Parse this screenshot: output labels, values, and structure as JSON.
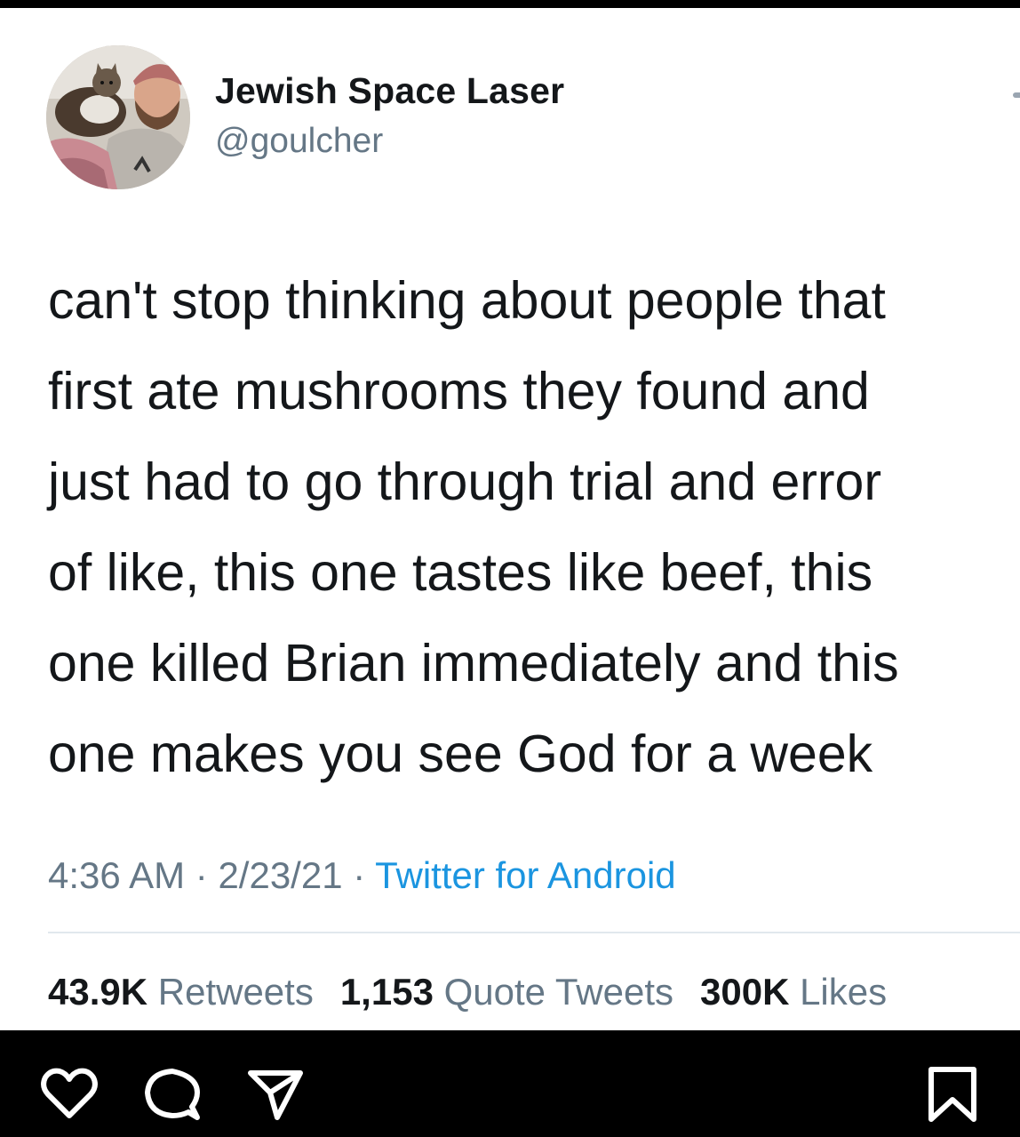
{
  "tweet": {
    "display_name": "Jewish Space Laser",
    "handle": "@goulcher",
    "text_lines": [
      "can't stop thinking about people that",
      "first ate mushrooms they found and",
      "just had to go through trial and error",
      "of like, this one tastes like beef, this",
      "one killed Brian immediately and this",
      "one makes you see God for a week"
    ],
    "time": "4:36 AM",
    "date": "2/23/21",
    "separator": "·",
    "source": "Twitter for Android",
    "stats": {
      "retweets_count": "43.9K",
      "retweets_label": "Retweets",
      "quotes_count": "1,153",
      "quotes_label": "Quote Tweets",
      "likes_count": "300K",
      "likes_label": "Likes"
    }
  },
  "action_bar": {
    "icons": [
      "heart-icon",
      "comment-icon",
      "send-icon",
      "bookmark-icon"
    ]
  },
  "colors": {
    "text_primary": "#14171a",
    "text_secondary": "#657786",
    "link": "#1b95e0",
    "divider": "#e1e8ed",
    "bar_background": "#000000"
  }
}
